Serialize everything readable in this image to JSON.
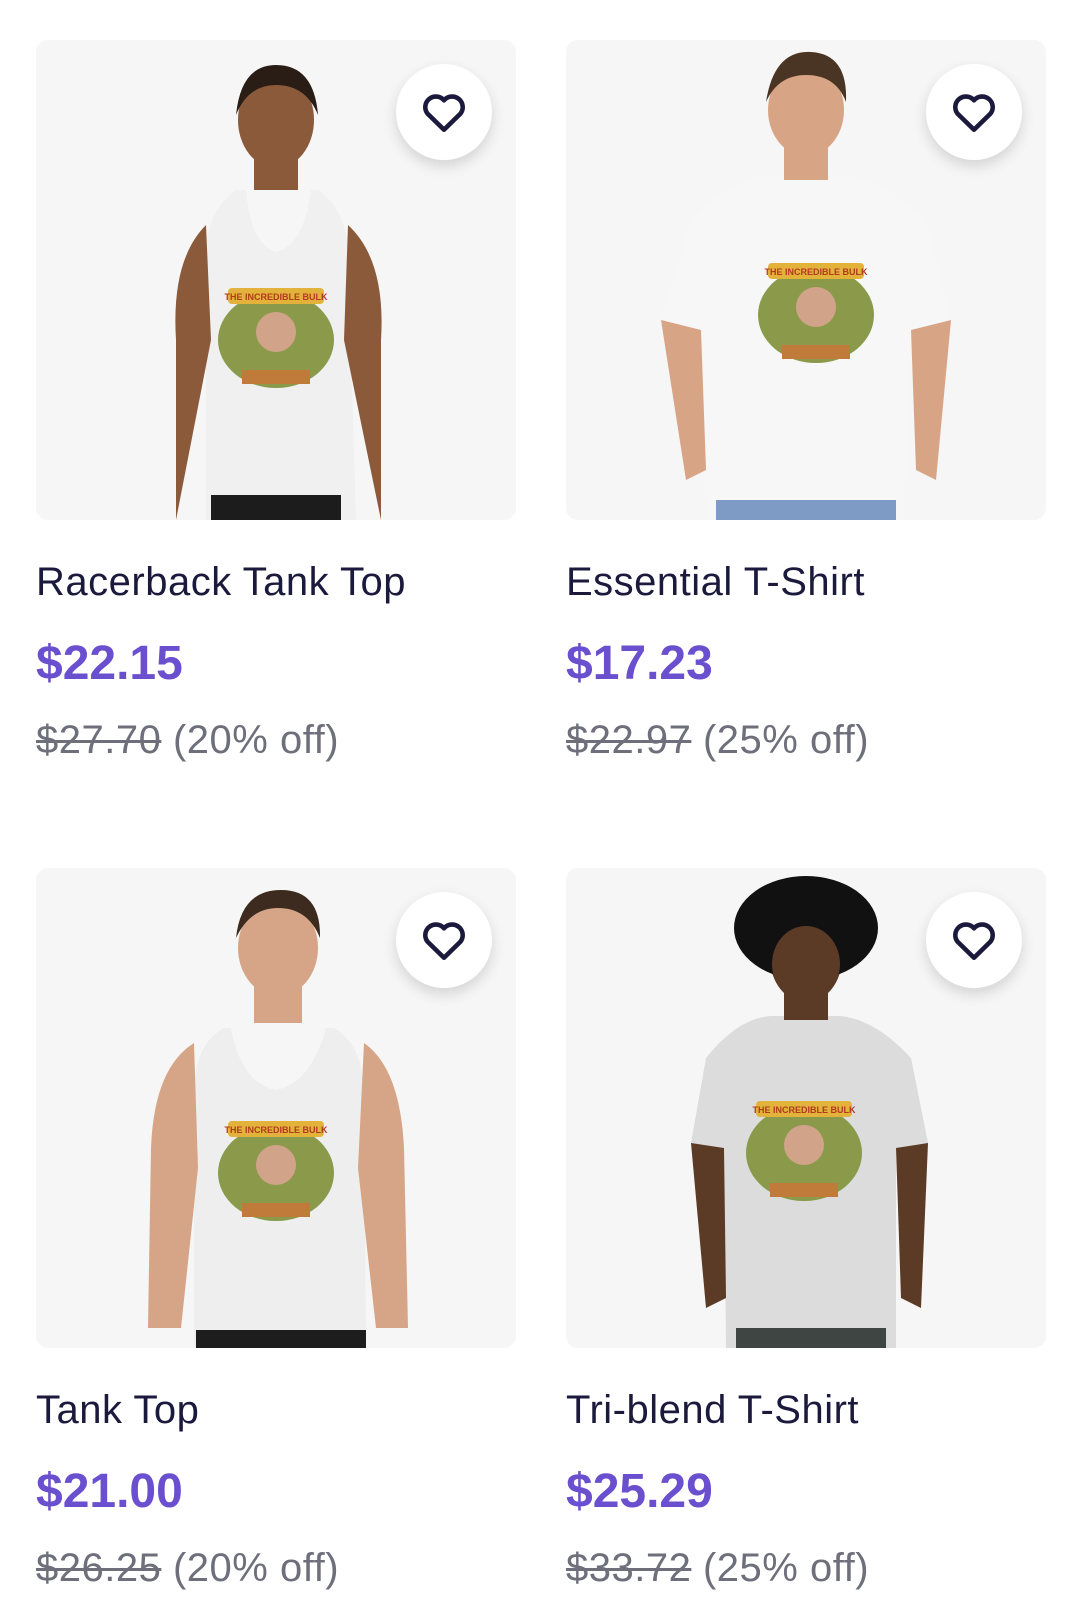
{
  "products": [
    {
      "title": "Racerback Tank Top",
      "price": "$22.15",
      "original_price": "$27.70",
      "discount": "(20% off)",
      "icon": "heart-outline-icon",
      "shirt_color": "#f0f0f0",
      "skin_color": "#8a5a3b",
      "hair_color": "#2a1d16",
      "pants_color": "#1c1c1c"
    },
    {
      "title": "Essential T-Shirt",
      "price": "$17.23",
      "original_price": "$22.97",
      "discount": "(25% off)",
      "icon": "heart-outline-icon",
      "shirt_color": "#f7f7f7",
      "skin_color": "#d8a486",
      "hair_color": "#4a3424",
      "pants_color": "#7d9bc4"
    },
    {
      "title": "Tank Top",
      "price": "$21.00",
      "original_price": "$26.25",
      "discount": "(20% off)",
      "icon": "heart-outline-icon",
      "shirt_color": "#eeeeee",
      "skin_color": "#d6a587",
      "hair_color": "#3d2b1f",
      "pants_color": "#1d1d1d"
    },
    {
      "title": "Tri-blend T-Shirt",
      "price": "$25.29",
      "original_price": "$33.72",
      "discount": "(25% off)",
      "icon": "heart-outline-icon",
      "shirt_color": "#dcdcdc",
      "skin_color": "#5b3a26",
      "hair_color": "#111111",
      "pants_color": "#3f4542"
    }
  ],
  "print_text": "THE INCREDIBLE BULK",
  "colors": {
    "price_accent": "#6a4fce",
    "title_text": "#1b1a3d",
    "muted_text": "#6f6f7c",
    "image_bg": "#f6f6f6"
  }
}
